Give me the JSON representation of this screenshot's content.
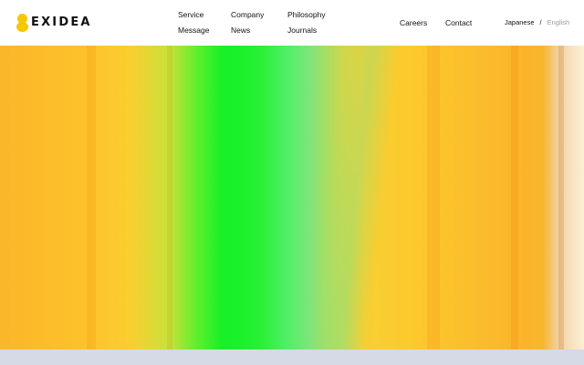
{
  "brand": {
    "name": "EXIDEA",
    "accent": "#f5c800"
  },
  "nav": {
    "service": "Service",
    "message": "Message",
    "company": "Company",
    "news": "News",
    "philosophy": "Philosophy",
    "journals": "Journals",
    "careers": "Careers",
    "contact": "Contact"
  },
  "language": {
    "japanese": "Japanese",
    "separator": "/",
    "english": "English"
  },
  "colors": {
    "hero_primary": "#fcc22b",
    "hero_green": "#18f028",
    "bottom_band": "#d6d9e6"
  }
}
